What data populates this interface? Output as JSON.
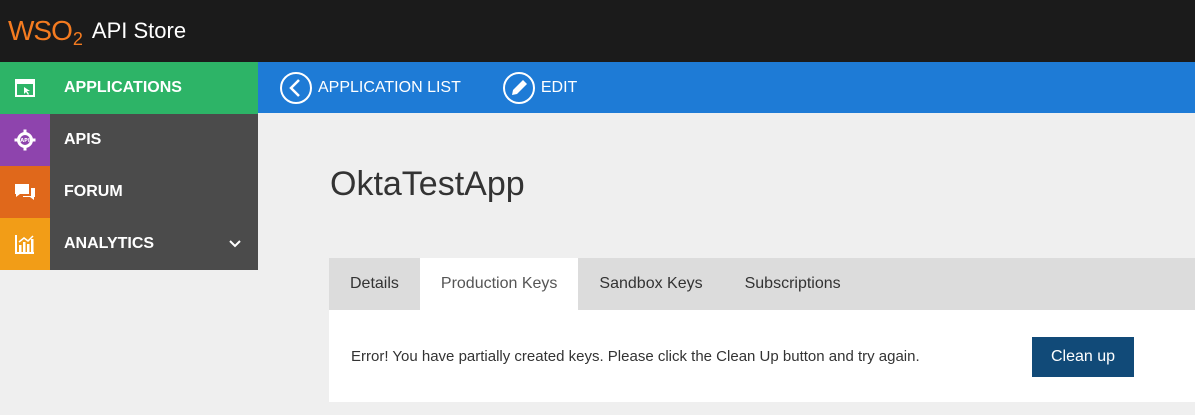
{
  "header": {
    "logo_text": "WSO",
    "logo_sub": "2",
    "title": "API Store"
  },
  "sidebar": {
    "items": [
      {
        "label": "APPLICATIONS",
        "icon": "applications-icon",
        "active": true
      },
      {
        "label": "APIS",
        "icon": "apis-gear-icon"
      },
      {
        "label": "FORUM",
        "icon": "forum-chat-icon"
      },
      {
        "label": "ANALYTICS",
        "icon": "analytics-chart-icon",
        "expandable": true
      }
    ]
  },
  "actionbar": {
    "list_label": "APPLICATION LIST",
    "edit_label": "EDIT"
  },
  "app": {
    "name": "OktaTestApp"
  },
  "tabs": [
    {
      "label": "Details"
    },
    {
      "label": "Production Keys",
      "active": true
    },
    {
      "label": "Sandbox Keys"
    },
    {
      "label": "Subscriptions"
    }
  ],
  "panel": {
    "error_text": "Error! You have partially created keys. Please click the Clean Up button and try again.",
    "cleanup_label": "Clean up"
  },
  "colors": {
    "topbar": "#1b1b1b",
    "brand_orange": "#f47b20",
    "applications_green": "#2db467",
    "apis_purple": "#8e44ad",
    "forum_orange": "#e0681b",
    "analytics_amber": "#f29d17",
    "actionbar_blue": "#1e7bd6",
    "button_navy": "#114a78"
  }
}
